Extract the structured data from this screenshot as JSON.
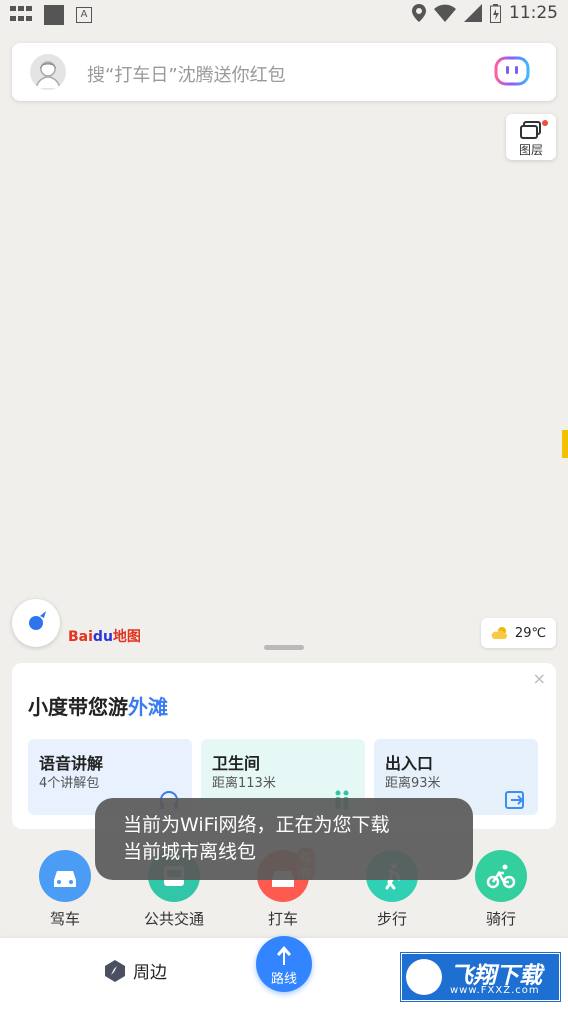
{
  "status_bar": {
    "time": "11:25",
    "icons": [
      "grid-icon",
      "square-icon",
      "a-icon",
      "location-icon",
      "wifi-icon",
      "signal-icon",
      "battery-icon"
    ]
  },
  "search": {
    "placeholder": "搜“打车日”沈腾送你红包",
    "avatar_icon": "avatar",
    "assistant_icon": "robot-icon"
  },
  "map_controls": {
    "layer_label": "图层",
    "brand_text": "Bai",
    "brand_paw": "du",
    "brand_suffix": "地图",
    "weather_temp": "29℃"
  },
  "guide": {
    "title_prefix": "小度带您游",
    "title_place": "外滩",
    "close": "×",
    "tiles": [
      {
        "title": "语音讲解",
        "subtitle": "4个讲解包",
        "bg": "#e8f1fd"
      },
      {
        "title": "卫生间",
        "subtitle": "距离113米",
        "bg": "#e6f8f5"
      },
      {
        "title": "出入口",
        "subtitle": "距离93米",
        "bg": "#e6f1fc"
      }
    ]
  },
  "transport": [
    {
      "label": "驾车",
      "color": "#4a9cf5"
    },
    {
      "label": "公共交通",
      "color": "#31c6a8"
    },
    {
      "label": "打车",
      "color": "#ff5a4f",
      "badge": "红包"
    },
    {
      "label": "步行",
      "color": "#2fd0b3"
    },
    {
      "label": "骑行",
      "color": "#34cf9f"
    }
  ],
  "bottom_nav": {
    "nearby": "周边",
    "route": "路线"
  },
  "watermark": {
    "big": "飞翔下载",
    "small": "www.FXXZ.com"
  },
  "toast": {
    "line1": "当前为WiFi网络，正在为您下载",
    "line2": "当前城市离线包"
  }
}
